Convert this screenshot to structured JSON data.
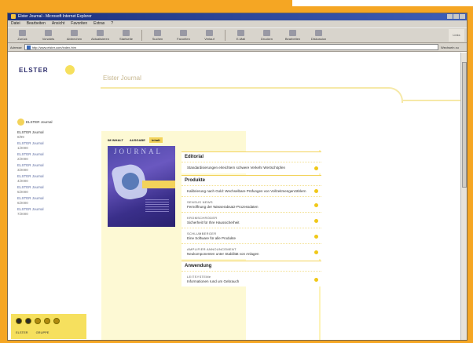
{
  "window": {
    "title": "Elster Journal - Microsoft Internet Explorer"
  },
  "menu": [
    "Datei",
    "Bearbeiten",
    "Ansicht",
    "Favoriten",
    "Extras",
    "?"
  ],
  "toolbar": {
    "buttons": [
      "Zurück",
      "Vorwärts",
      "Abbrechen",
      "Aktualisieren",
      "Startseite",
      "Suchen",
      "Favoriten",
      "Verlauf",
      "E-Mail",
      "Drucken",
      "Bearbeiten",
      "Diskussion"
    ],
    "throbber_label": "Links"
  },
  "address": {
    "label": "Adresse",
    "value": "http://www.elster.com/index.htm",
    "links_label": "Wechseln zu"
  },
  "sidebar": {
    "logo": "ELSTER",
    "active_item": "ELSTER Journal",
    "items": [
      {
        "label": "ELSTER Journal",
        "year": "8/99"
      },
      {
        "label": "ELSTER Journal",
        "year": "1/2000"
      },
      {
        "label": "ELSTER Journal",
        "year": "2/2000"
      },
      {
        "label": "ELSTER Journal",
        "year": "3/2000"
      },
      {
        "label": "ELSTER Journal",
        "year": "4/2000"
      },
      {
        "label": "ELSTER Journal",
        "year": "5/2000"
      },
      {
        "label": "ELSTER Journal",
        "year": "6/2000"
      },
      {
        "label": "ELSTER Journal",
        "year": "7/2000"
      }
    ],
    "bottom_labels": [
      "ELSTER",
      "GRUPPE"
    ]
  },
  "main": {
    "title": "Elster Journal",
    "tabs": [
      "IM INHALT",
      "AUSGABE",
      "Inhalt"
    ],
    "cover_title": "JOURNAL",
    "sections": [
      {
        "heading": "Editorial",
        "articles": [
          {
            "kicker": "",
            "text": "Standardisierungen erleichtern schwere Verkehr Wertschöpfen"
          }
        ]
      },
      {
        "heading": "Produkte",
        "articles": [
          {
            "kicker": "",
            "text": "Kalibrierung nach Gold: Wechselbare Prüfungen von Vollzeitmengenzählern"
          },
          {
            "kicker": "SENSUS NEWS",
            "text": "Fernöffnung der Wasserabsatz-Prozessdaten"
          },
          {
            "kicker": "KROMSCHRÖDER",
            "text": "Sicherheit für Ihre Haussicherheit"
          },
          {
            "kicker": "SCHLUMBERGER",
            "text": "Eine Software für alle Produkte"
          },
          {
            "kicker": "AMPLIFIER ANNOUNCEMENT",
            "text": "Neukomponenten unter Stabilität von Anlagen"
          }
        ]
      },
      {
        "heading": "Anwendung",
        "articles": [
          {
            "kicker": "LEITSYSTEMe",
            "text": "Informationen rund um Gebrauch"
          }
        ]
      }
    ]
  },
  "colors": {
    "frame": "#f5a623",
    "accent_yellow": "#f3d35a",
    "light_yellow": "#fdf9d4",
    "cover_purple": "#4e48a8"
  }
}
